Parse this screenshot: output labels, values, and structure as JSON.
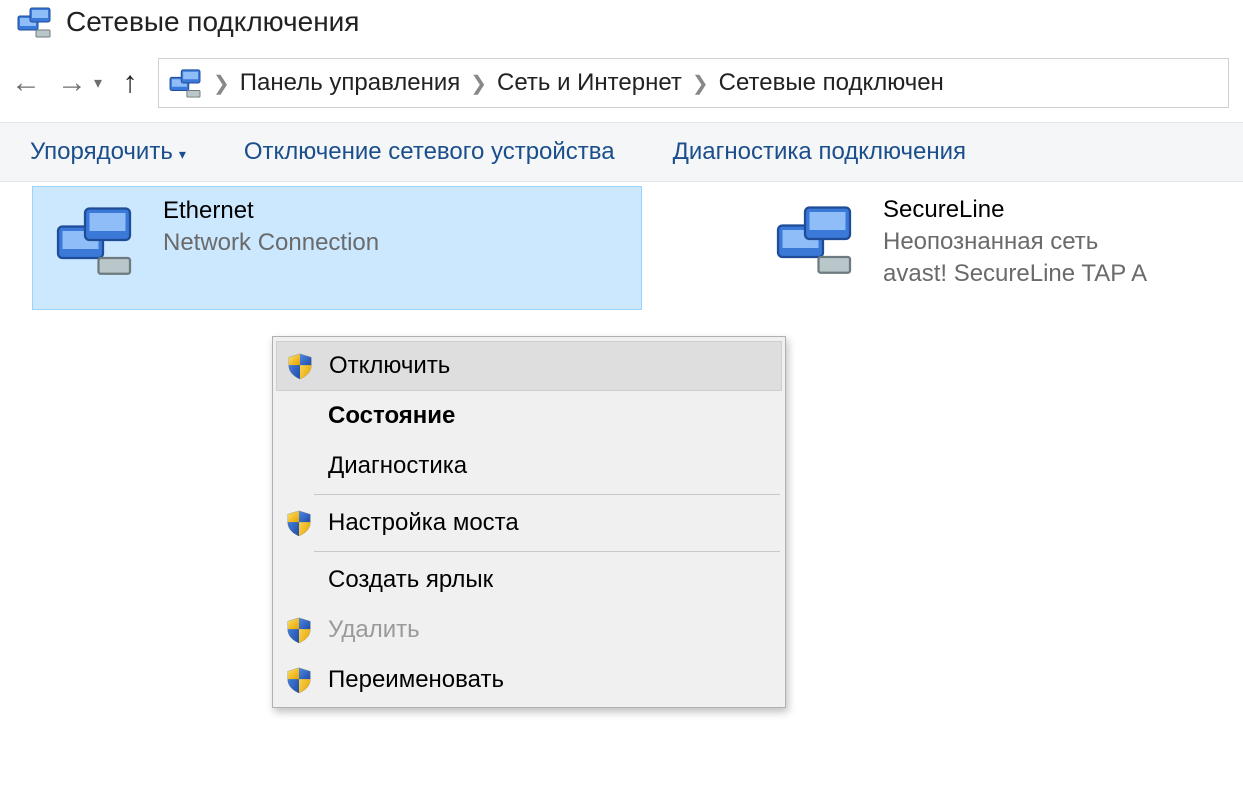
{
  "window": {
    "title": "Сетевые подключения"
  },
  "breadcrumb": {
    "a": "Панель управления",
    "b": "Сеть и Интернет",
    "c": "Сетевые подключен"
  },
  "toolbar": {
    "organize": "Упорядочить",
    "disable_device": "Отключение сетевого устройства",
    "diagnose": "Диагностика подключения"
  },
  "connections": {
    "ethernet": {
      "name": "Ethernet",
      "sub": "Network Connection"
    },
    "secureline": {
      "name": "SecureLine",
      "sub1": "Неопознанная сеть",
      "sub2": "avast! SecureLine TAP A"
    }
  },
  "context_menu": {
    "disable": "Отключить",
    "status": "Состояние",
    "diagnose": "Диагностика",
    "bridge": "Настройка моста",
    "shortcut": "Создать ярлык",
    "delete": "Удалить",
    "rename": "Переименовать"
  }
}
